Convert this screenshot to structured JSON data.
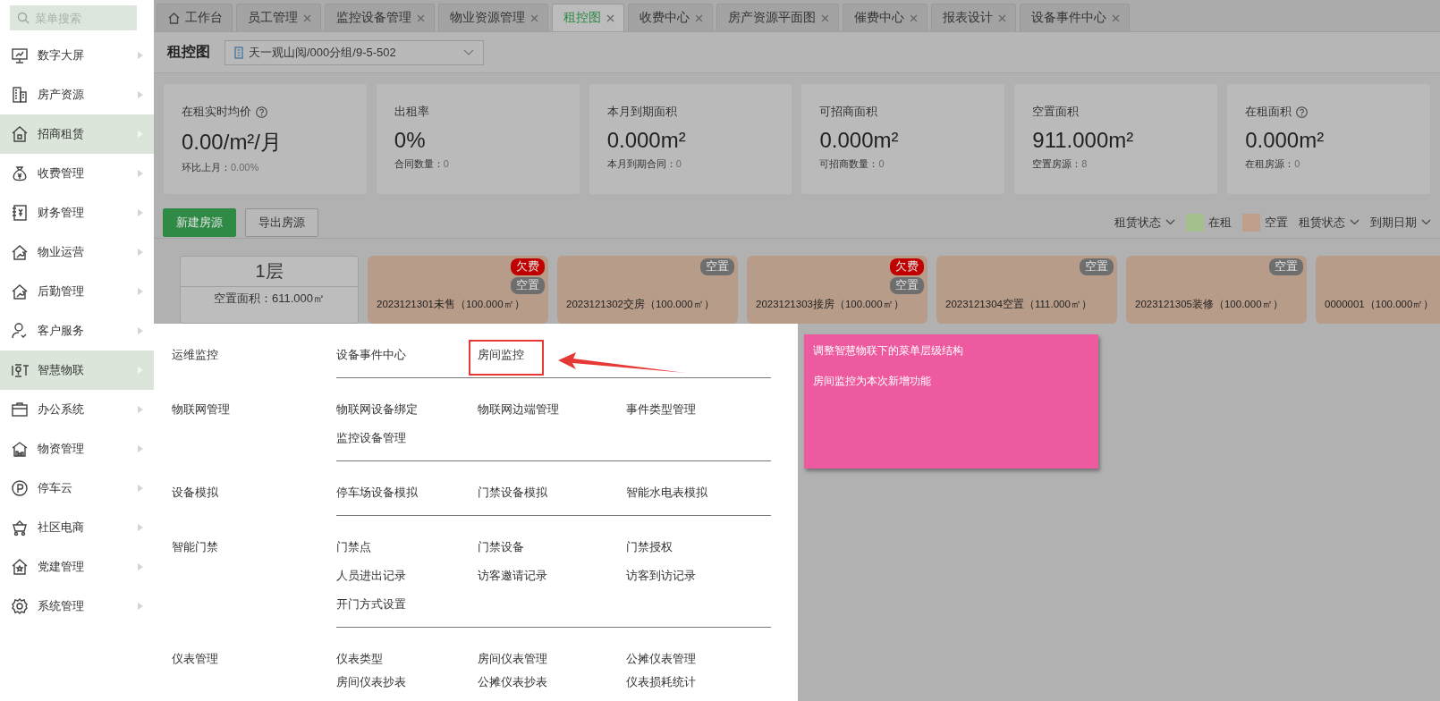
{
  "sidebar": {
    "search": {
      "placeholder": "菜单搜索"
    },
    "items": [
      {
        "label": "数字大屏",
        "selected": false
      },
      {
        "label": "房产资源",
        "selected": false
      },
      {
        "label": "招商租赁",
        "selected": true
      },
      {
        "label": "收费管理",
        "selected": false
      },
      {
        "label": "财务管理",
        "selected": false
      },
      {
        "label": "物业运营",
        "selected": false
      },
      {
        "label": "后勤管理",
        "selected": false
      },
      {
        "label": "客户服务",
        "selected": false
      },
      {
        "label": "智慧物联",
        "selected": true
      },
      {
        "label": "办公系统",
        "selected": false
      },
      {
        "label": "物资管理",
        "selected": false
      },
      {
        "label": "停车云",
        "selected": false
      },
      {
        "label": "社区电商",
        "selected": false
      },
      {
        "label": "党建管理",
        "selected": false
      },
      {
        "label": "系统管理",
        "selected": false
      }
    ]
  },
  "tabs": [
    {
      "label": "工作台",
      "kind": "home",
      "selected": false
    },
    {
      "label": "员工管理",
      "kind": "closable",
      "selected": false
    },
    {
      "label": "监控设备管理",
      "kind": "closable",
      "selected": false
    },
    {
      "label": "物业资源管理",
      "kind": "closable",
      "selected": false
    },
    {
      "label": "租控图",
      "kind": "closable",
      "selected": true
    },
    {
      "label": "收费中心",
      "kind": "closable",
      "selected": false
    },
    {
      "label": "房产资源平面图",
      "kind": "closable",
      "selected": false
    },
    {
      "label": "催费中心",
      "kind": "closable",
      "selected": false
    },
    {
      "label": "报表设计",
      "kind": "closable",
      "selected": false
    },
    {
      "label": "设备事件中心",
      "kind": "closable",
      "selected": false
    }
  ],
  "header": {
    "title": "租控图",
    "location": "天一观山阅/000分组/9-5-502"
  },
  "stats": [
    {
      "label": "在租实时均价",
      "help": true,
      "value": "0.00/m²/月",
      "sub_label": "环比上月：",
      "sub_value": "0.00%"
    },
    {
      "label": "出租率",
      "help": false,
      "value": "0%",
      "sub_label": "合同数量：",
      "sub_value": "0"
    },
    {
      "label": "本月到期面积",
      "help": false,
      "value": "0.000m²",
      "sub_label": "本月到期合同：",
      "sub_value": "0"
    },
    {
      "label": "可招商面积",
      "help": false,
      "value": "0.000m²",
      "sub_label": "可招商数量：",
      "sub_value": "0"
    },
    {
      "label": "空置面积",
      "help": false,
      "value": "911.000m²",
      "sub_label": "空置房源：",
      "sub_value": "8"
    },
    {
      "label": "在租面积",
      "help": true,
      "value": "0.000m²",
      "sub_label": "在租房源：",
      "sub_value": "0"
    }
  ],
  "toolbar": {
    "buttons": [
      {
        "label": "新建房源",
        "kind": "primary"
      },
      {
        "label": "导出房源",
        "kind": "default"
      }
    ],
    "controls": [
      {
        "kind": "filter",
        "label": "租赁状态"
      },
      {
        "kind": "legend",
        "label": "在租",
        "color": "#a3bf8e"
      },
      {
        "kind": "legend",
        "label": "空置",
        "color": "#bf9f8b"
      },
      {
        "kind": "filter",
        "label": "租赁状态"
      },
      {
        "kind": "filter",
        "label": "到期日期"
      }
    ]
  },
  "floor": {
    "title": "1层",
    "vacant_area": "空置面积：611.000㎡"
  },
  "rooms": [
    {
      "label": "2023121301未售（100.000㎡）",
      "badges": [
        {
          "label": "欠费",
          "color": "#c00000"
        },
        {
          "label": "空置",
          "color": "#6e6e6e"
        }
      ]
    },
    {
      "label": "2023121302交房（100.000㎡）",
      "badges": [
        {
          "label": "空置",
          "color": "#6e6e6e"
        }
      ]
    },
    {
      "label": "2023121303接房（100.000㎡）",
      "badges": [
        {
          "label": "欠费",
          "color": "#c00000"
        },
        {
          "label": "空置",
          "color": "#6e6e6e"
        }
      ]
    },
    {
      "label": "2023121304空置（111.000㎡）",
      "badges": [
        {
          "label": "空置",
          "color": "#6e6e6e"
        }
      ]
    },
    {
      "label": "2023121305装修（100.000㎡）",
      "badges": [
        {
          "label": "空置",
          "color": "#6e6e6e"
        }
      ]
    },
    {
      "label": "0000001（100.000㎡）"
    }
  ],
  "popup_menu": {
    "groups": [
      {
        "label": "运维监控",
        "items": [
          {
            "label": "设备事件中心",
            "highlighted": false
          },
          {
            "label": "房间监控",
            "highlighted": true
          }
        ]
      },
      {
        "label": "物联网管理",
        "items": [
          {
            "label": "物联网设备绑定",
            "highlighted": false
          },
          {
            "label": "物联网边端管理",
            "highlighted": false
          },
          {
            "label": "事件类型管理",
            "highlighted": false
          },
          {
            "label": "监控设备管理",
            "highlighted": false
          }
        ]
      },
      {
        "label": "设备模拟",
        "items": [
          {
            "label": "停车场设备模拟",
            "highlighted": false
          },
          {
            "label": "门禁设备模拟",
            "highlighted": false
          },
          {
            "label": "智能水电表模拟",
            "highlighted": false
          }
        ]
      },
      {
        "label": "智能门禁",
        "items": [
          {
            "label": "门禁点",
            "highlighted": false
          },
          {
            "label": "门禁设备",
            "highlighted": false
          },
          {
            "label": "门禁授权",
            "highlighted": false
          },
          {
            "label": "人员进出记录",
            "highlighted": false
          },
          {
            "label": "访客邀请记录",
            "highlighted": false
          },
          {
            "label": "访客到访记录",
            "highlighted": false
          },
          {
            "label": "开门方式设置",
            "highlighted": false
          }
        ]
      },
      {
        "label": "仪表管理",
        "items": [
          {
            "label": "仪表类型",
            "highlighted": false
          },
          {
            "label": "房间仪表管理",
            "highlighted": false
          },
          {
            "label": "公摊仪表管理",
            "highlighted": false
          },
          {
            "label": "房间仪表抄表",
            "highlighted": false
          },
          {
            "label": "公摊仪表抄表",
            "highlighted": false
          },
          {
            "label": "仪表损耗统计",
            "highlighted": false
          }
        ]
      }
    ]
  },
  "note": {
    "lines": [
      "调整智慧物联下的菜单层级结构",
      "房间监控为本次新增功能"
    ]
  }
}
